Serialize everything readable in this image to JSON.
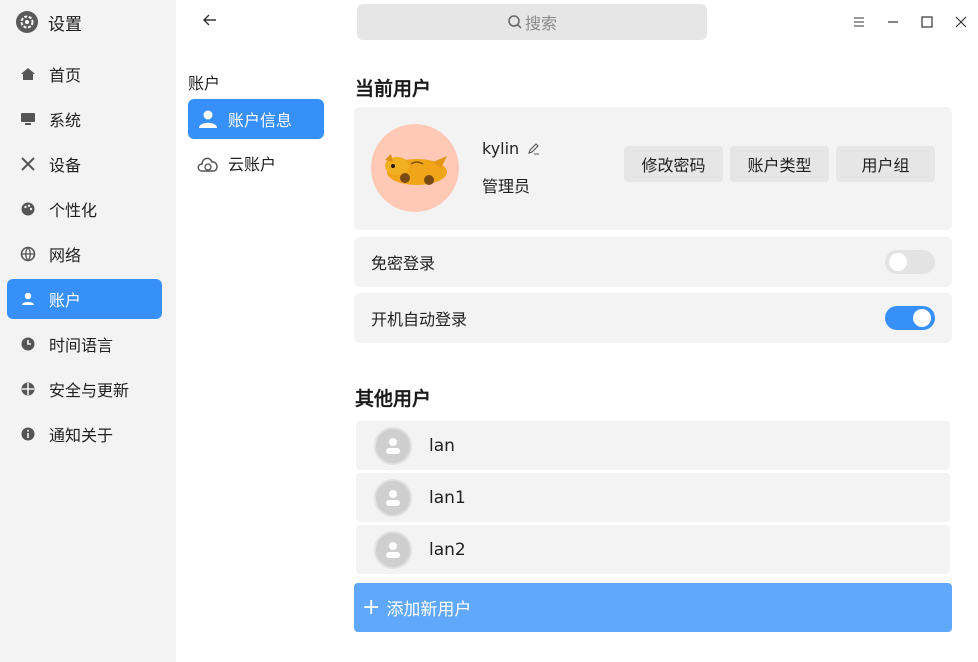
{
  "app": {
    "title": "设置"
  },
  "sidebar": {
    "items": [
      {
        "label": "首页",
        "icon": "home-icon"
      },
      {
        "label": "系统",
        "icon": "monitor-icon"
      },
      {
        "label": "设备",
        "icon": "tools-icon"
      },
      {
        "label": "个性化",
        "icon": "palette-icon"
      },
      {
        "label": "网络",
        "icon": "globe-icon"
      },
      {
        "label": "账户",
        "icon": "user-icon",
        "active": true
      },
      {
        "label": "时间语言",
        "icon": "clock-icon"
      },
      {
        "label": "安全与更新",
        "icon": "shield-icon"
      },
      {
        "label": "通知关于",
        "icon": "info-icon"
      }
    ]
  },
  "subnav": {
    "title": "账户",
    "items": [
      {
        "label": "账户信息",
        "icon": "user-icon",
        "active": true
      },
      {
        "label": "云账户",
        "icon": "cloud-icon"
      }
    ]
  },
  "search": {
    "placeholder": "搜索"
  },
  "current_user": {
    "section_title": "当前用户",
    "username": "kylin",
    "type": "管理员",
    "buttons": {
      "change_password": "修改密码",
      "account_type": "账户类型",
      "user_group": "用户组"
    }
  },
  "options": {
    "passwordless_login": {
      "label": "免密登录",
      "enabled": false
    },
    "auto_login": {
      "label": "开机自动登录",
      "enabled": true
    }
  },
  "other_users": {
    "section_title": "其他用户",
    "users": [
      "lan",
      "lan1",
      "lan2"
    ],
    "add_label": "添加新用户"
  },
  "colors": {
    "accent": "#3790fa",
    "add_button": "#5fa8fb",
    "card_bg": "#f3f3f3"
  }
}
